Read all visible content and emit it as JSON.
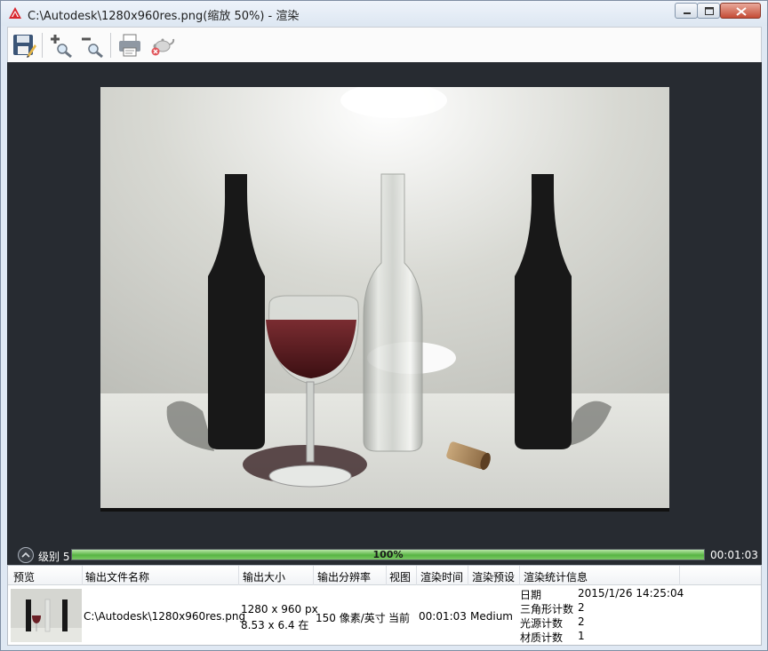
{
  "window": {
    "title": "C:\\Autodesk\\1280x960res.png(缩放 50%) - 渲染"
  },
  "toolbar": {
    "buttons": [
      {
        "icon": "save-icon"
      },
      {
        "icon": "zoom-in-icon"
      },
      {
        "icon": "zoom-out-icon"
      },
      {
        "icon": "print-icon"
      },
      {
        "icon": "cancel-render-teapot-icon"
      }
    ]
  },
  "status": {
    "level_label": "级别 5",
    "progress_percent": 100,
    "progress_text": "100%",
    "elapsed": "00:01:03",
    "progress_color": "#57b443"
  },
  "history": {
    "columns": [
      "预览",
      "输出文件名称",
      "输出大小",
      "输出分辨率",
      "视图",
      "渲染时间",
      "渲染预设",
      "渲染统计信息"
    ],
    "row": {
      "filename": "C:\\Autodesk\\1280x960res.png",
      "size_px": "1280 x 960  px",
      "size_in": "8.53 x 6.4  在",
      "resolution": "150 像素/英寸",
      "view": "当前",
      "render_time": "00:01:03",
      "preset": "Medium",
      "stats": [
        {
          "label": "日期",
          "value": "2015/1/26 14:25:04"
        },
        {
          "label": "三角形计数",
          "value": "2"
        },
        {
          "label": "光源计数",
          "value": "2"
        },
        {
          "label": "材质计数",
          "value": "1"
        }
      ]
    }
  }
}
